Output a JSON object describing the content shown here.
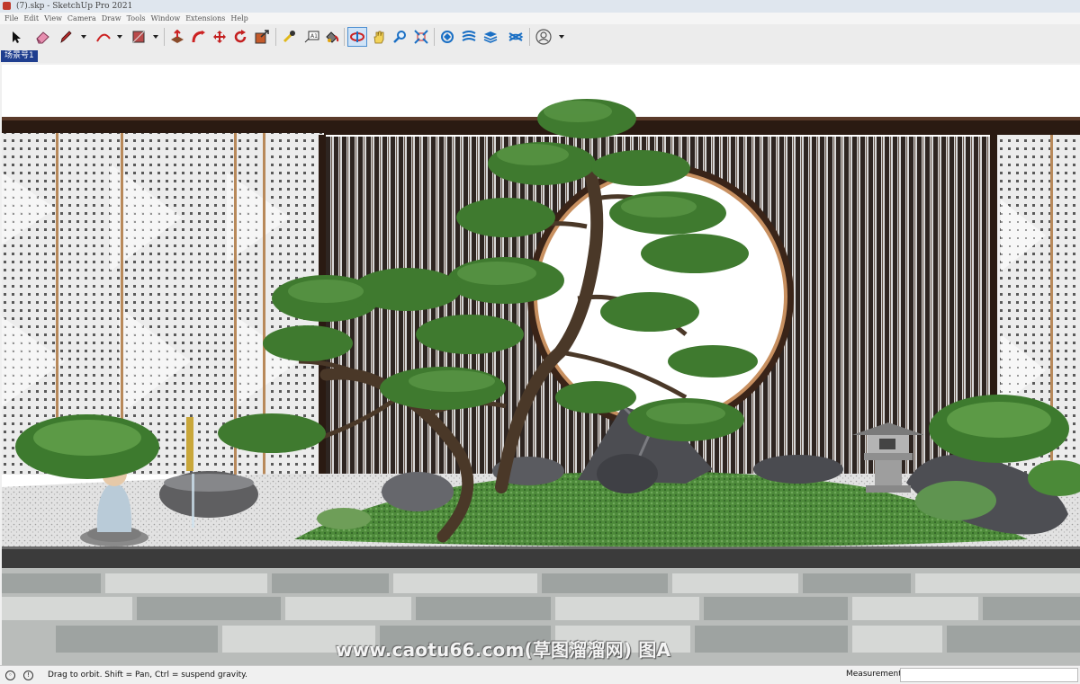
{
  "window": {
    "title": "(7).skp - SketchUp Pro 2021"
  },
  "menu": {
    "items": [
      "File",
      "Edit",
      "View",
      "Camera",
      "Draw",
      "Tools",
      "Window",
      "Extensions",
      "Help"
    ]
  },
  "toolbar": {
    "tools": [
      {
        "name": "select-tool",
        "icon": "cursor-arrow-icon"
      },
      {
        "name": "eraser-tool",
        "icon": "eraser-icon"
      },
      {
        "name": "line-tool",
        "icon": "pencil-icon",
        "dropdown": true
      },
      {
        "name": "arc-tool",
        "icon": "arc-icon",
        "dropdown": true
      },
      {
        "name": "rectangle-tool",
        "icon": "rectangle-icon",
        "dropdown": true
      },
      {
        "name": "push-pull-tool",
        "icon": "push-pull-icon"
      },
      {
        "name": "follow-me-tool",
        "icon": "follow-me-icon"
      },
      {
        "name": "move-tool",
        "icon": "move-arrows-icon"
      },
      {
        "name": "rotate-tool",
        "icon": "rotate-icon"
      },
      {
        "name": "scale-tool",
        "icon": "scale-icon"
      },
      {
        "name": "tape-measure-tool",
        "icon": "tape-measure-icon"
      },
      {
        "name": "text-tool",
        "icon": "text-label-icon"
      },
      {
        "name": "paint-bucket-tool",
        "icon": "paint-bucket-icon"
      },
      {
        "name": "orbit-tool",
        "icon": "orbit-icon",
        "active": true
      },
      {
        "name": "pan-tool",
        "icon": "hand-icon"
      },
      {
        "name": "zoom-tool",
        "icon": "zoom-magnifier-icon"
      },
      {
        "name": "zoom-extents-tool",
        "icon": "zoom-extents-icon"
      },
      {
        "name": "warehouse-button",
        "icon": "3d-warehouse-icon"
      },
      {
        "name": "extension-warehouse-button",
        "icon": "extension-warehouse-icon"
      },
      {
        "name": "layout-button",
        "icon": "layout-icon"
      },
      {
        "name": "extension-manager-button",
        "icon": "extension-manager-icon"
      },
      {
        "name": "account-button",
        "icon": "user-circle-icon",
        "dropdown": true
      }
    ],
    "icon_color": "#1a6fc4"
  },
  "scenes": {
    "tabs": [
      "场景号1"
    ]
  },
  "viewport": {
    "watermark": "www.caotu66.com(草图溜溜网) 图A",
    "sky_color": "#ffffff",
    "wall_color": "#e9e9e9",
    "slat_color": "#2e2521",
    "frame_color": "#3a2418",
    "foliage_color": "#3f7a2f",
    "gravel_color": "#dcdcdc",
    "paving_color": "#b9bcba"
  },
  "status": {
    "message": "Drag to orbit. Shift = Pan, Ctrl = suspend gravity.",
    "measurements_label": "Measurements",
    "measurements_value": ""
  }
}
